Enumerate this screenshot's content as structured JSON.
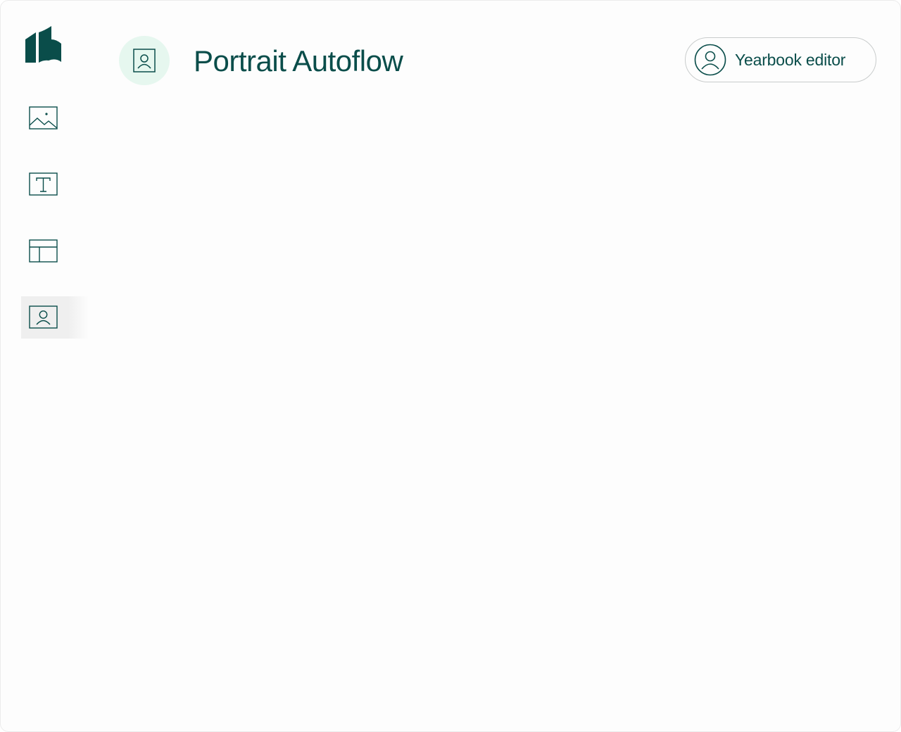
{
  "app": {
    "accent_color": "#0a4d4a",
    "logo_icon": "brand-logo-icon"
  },
  "sidebar": {
    "items": [
      {
        "icon": "image-icon",
        "active": false
      },
      {
        "icon": "text-icon",
        "active": false
      },
      {
        "icon": "layout-icon",
        "active": false
      },
      {
        "icon": "portrait-icon",
        "active": true
      }
    ]
  },
  "header": {
    "icon": "portrait-icon",
    "title": "Portrait Autoflow",
    "badge_color": "#e6f7ef"
  },
  "user_menu": {
    "icon": "user-avatar-icon",
    "label": "Yearbook editor"
  }
}
